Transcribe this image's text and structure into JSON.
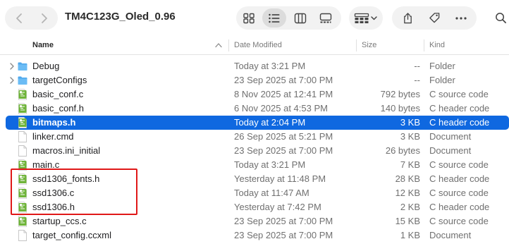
{
  "window": {
    "title": "TM4C123G_Oled_0.96"
  },
  "columns": {
    "name": "Name",
    "date": "Date Modified",
    "size": "Size",
    "kind": "Kind"
  },
  "files": [
    {
      "name": "Debug",
      "date": "Today at 3:21 PM",
      "size": "--",
      "kind": "Folder",
      "icon": "folder-icon",
      "expandable": true
    },
    {
      "name": "targetConfigs",
      "date": "23 Sep 2025 at 7:00 PM",
      "size": "--",
      "kind": "Folder",
      "icon": "folder-icon",
      "expandable": true
    },
    {
      "name": "basic_conf.c",
      "date": "8 Nov 2025 at 12:41 PM",
      "size": "792 bytes",
      "kind": "C source code",
      "icon": "c-file-icon"
    },
    {
      "name": "basic_conf.h",
      "date": "6 Nov 2025 at 4:53 PM",
      "size": "140 bytes",
      "kind": "C header code",
      "icon": "c-file-icon"
    },
    {
      "name": "bitmaps.h",
      "date": "Today at 2:04 PM",
      "size": "3 KB",
      "kind": "C header code",
      "icon": "c-file-icon",
      "selected": true
    },
    {
      "name": "linker.cmd",
      "date": "26 Sep 2025 at 5:21 PM",
      "size": "3 KB",
      "kind": "Document",
      "icon": "document-icon"
    },
    {
      "name": "macros.ini_initial",
      "date": "23 Sep 2025 at 7:00 PM",
      "size": "26 bytes",
      "kind": "Document",
      "icon": "document-icon"
    },
    {
      "name": "main.c",
      "date": "Today at 3:21 PM",
      "size": "7 KB",
      "kind": "C source code",
      "icon": "c-file-icon"
    },
    {
      "name": "ssd1306_fonts.h",
      "date": "Yesterday at 11:48 PM",
      "size": "28 KB",
      "kind": "C header code",
      "icon": "c-file-icon"
    },
    {
      "name": "ssd1306.c",
      "date": "Today at 11:47 AM",
      "size": "12 KB",
      "kind": "C source code",
      "icon": "c-file-icon"
    },
    {
      "name": "ssd1306.h",
      "date": "Yesterday at 7:42 PM",
      "size": "2 KB",
      "kind": "C header code",
      "icon": "c-file-icon"
    },
    {
      "name": "startup_ccs.c",
      "date": "23 Sep 2025 at 7:00 PM",
      "size": "15 KB",
      "kind": "C source code",
      "icon": "c-file-icon"
    },
    {
      "name": "target_config.ccxml",
      "date": "23 Sep 2025 at 7:00 PM",
      "size": "1 KB",
      "kind": "Document",
      "icon": "document-icon"
    }
  ],
  "colors": {
    "selection": "#0f68e0",
    "highlight_box": "#e01818",
    "c_file_icon": "#6fb43a",
    "folder": "#4fa8ec"
  }
}
